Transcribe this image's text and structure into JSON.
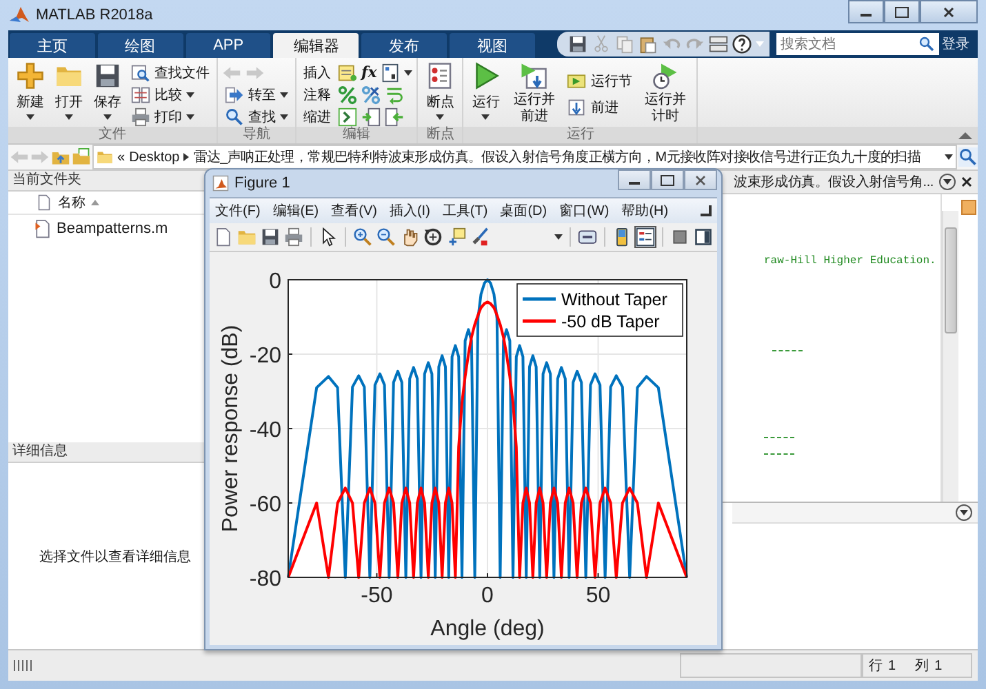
{
  "window": {
    "title": "MATLAB R2018a"
  },
  "tabs": [
    {
      "label": "主页",
      "selected": false
    },
    {
      "label": "绘图",
      "selected": false
    },
    {
      "label": "APP",
      "selected": false
    },
    {
      "label": "编辑器",
      "selected": true
    },
    {
      "label": "发布",
      "selected": false
    },
    {
      "label": "视图",
      "selected": false
    }
  ],
  "search": {
    "placeholder": "搜索文档"
  },
  "login": "登录",
  "ribbon": {
    "file": {
      "label": "文件",
      "new": "新建",
      "open": "打开",
      "save": "保存",
      "find_files": "查找文件",
      "compare": "比较",
      "print": "打印"
    },
    "navigate": {
      "label": "导航",
      "go_to": "转至",
      "find": "查找"
    },
    "edit": {
      "label": "编辑",
      "insert": "插入",
      "fx": "fx",
      "comment": "注释",
      "indent": "缩进"
    },
    "breakpoints": {
      "label": "断点",
      "breakpoints": "断点"
    },
    "run": {
      "label": "运行",
      "run": "运行",
      "run_and_advance": "运行并前进",
      "run_section": "运行节",
      "advance": "前进",
      "run_and_time": "运行并计时"
    }
  },
  "address": {
    "overflow": "«",
    "folder": "Desktop",
    "path": "雷达_声呐正处理，常规巴特利特波束形成仿真。假设入射信号角度正横方向，M元接收阵对接收信号进行正负九十度的扫描"
  },
  "current_folder": {
    "title": "当前文件夹",
    "column": "名称",
    "files": [
      {
        "name": "Beampatterns.m"
      }
    ]
  },
  "details": {
    "title": "详细信息",
    "message": "选择文件以查看详细信息"
  },
  "editor": {
    "tab_title": "波束形成仿真。假设入射信号角...",
    "code_lines": [
      "raw-Hill Higher Education."
    ]
  },
  "figure": {
    "title": "Figure 1",
    "menu": [
      "文件(F)",
      "编辑(E)",
      "查看(V)",
      "插入(I)",
      "工具(T)",
      "桌面(D)",
      "窗口(W)",
      "帮助(H)"
    ],
    "chart_data": {
      "type": "line",
      "xlabel": "Angle (deg)",
      "ylabel": "Power response (dB)",
      "x": [
        -90,
        -77.2,
        -71.8,
        -67.7,
        -64.2,
        -61,
        -58.2,
        -55.6,
        -53.1,
        -50.8,
        -48.6,
        -46.5,
        -44.4,
        -42.4,
        -40.5,
        -38.7,
        -36.9,
        -35.1,
        -33.4,
        -31.7,
        -30,
        -28.4,
        -26.7,
        -25.1,
        -23.6,
        -22,
        -20.5,
        -19,
        -17.5,
        -16,
        -14.5,
        -13,
        -11.5,
        -10.1,
        -8.6,
        -7.2,
        -5.7,
        -4.3,
        -2.9,
        -1.4,
        0,
        1.4,
        2.9,
        4.3,
        5.7,
        7.2,
        8.6,
        10.1,
        11.5,
        13,
        14.5,
        16,
        17.5,
        19,
        20.5,
        22,
        23.6,
        25.1,
        26.7,
        28.4,
        30,
        31.7,
        33.4,
        35.1,
        36.9,
        38.7,
        40.5,
        42.4,
        44.4,
        46.5,
        48.6,
        50.8,
        53.1,
        55.6,
        58.2,
        61,
        64.2,
        67.7,
        71.8,
        77.2,
        90
      ],
      "series": [
        {
          "name": "Without Taper",
          "color": "#0072bd",
          "values": [
            -80,
            -29,
            -26,
            -29,
            -80,
            -28.8,
            -25.8,
            -28.8,
            -80,
            -28.3,
            -25.3,
            -28.3,
            -80,
            -27.6,
            -24.6,
            -27.6,
            -80,
            -26.6,
            -23.6,
            -26.6,
            -80,
            -25.3,
            -22.3,
            -25.3,
            -80,
            -23.4,
            -20.4,
            -23.4,
            -80,
            -20.7,
            -17.7,
            -20.7,
            -80,
            -16.4,
            -13.4,
            -16.4,
            -80,
            -10.4,
            -3.9,
            -0.9,
            0,
            -0.9,
            -3.9,
            -10.4,
            -80,
            -16.4,
            -13.4,
            -16.4,
            -80,
            -20.7,
            -17.7,
            -20.7,
            -80,
            -23.4,
            -20.4,
            -23.4,
            -80,
            -25.3,
            -22.3,
            -25.3,
            -80,
            -26.6,
            -23.6,
            -26.6,
            -80,
            -27.6,
            -24.6,
            -27.6,
            -80,
            -28.3,
            -25.3,
            -28.3,
            -80,
            -28.8,
            -25.8,
            -28.8,
            -80,
            -29,
            -26,
            -29,
            -80
          ]
        },
        {
          "name": "-50 dB Taper",
          "color": "#ff0000",
          "values": [
            -80,
            -60,
            -80,
            -60,
            -56,
            -60,
            -80,
            -60,
            -56,
            -60,
            -80,
            -60,
            -56,
            -60,
            -80,
            -60,
            -56,
            -60,
            -80,
            -60,
            -56,
            -60,
            -80,
            -60,
            -56,
            -60,
            -80,
            -60,
            -56,
            -60,
            -80,
            -45,
            -33,
            -26,
            -20,
            -15.5,
            -12,
            -9.5,
            -7.5,
            -6.4,
            -6,
            -6.4,
            -7.5,
            -9.5,
            -12,
            -15.5,
            -20,
            -26,
            -33,
            -45,
            -80,
            -60,
            -56,
            -60,
            -80,
            -60,
            -56,
            -60,
            -80,
            -60,
            -56,
            -60,
            -80,
            -60,
            -56,
            -60,
            -80,
            -60,
            -56,
            -60,
            -80,
            -60,
            -56,
            -60,
            -80,
            -60,
            -56,
            -60,
            -80,
            -60,
            -80
          ]
        }
      ],
      "xlim": [
        -90,
        90
      ],
      "ylim": [
        -80,
        0
      ],
      "xticks": [
        -50,
        0,
        50
      ],
      "yticks": [
        -80,
        -60,
        -40,
        -20,
        0
      ],
      "grid": true,
      "legend": true
    }
  },
  "status_bar": {
    "row_label": "行",
    "row": "1",
    "col_label": "列",
    "col": "1"
  }
}
